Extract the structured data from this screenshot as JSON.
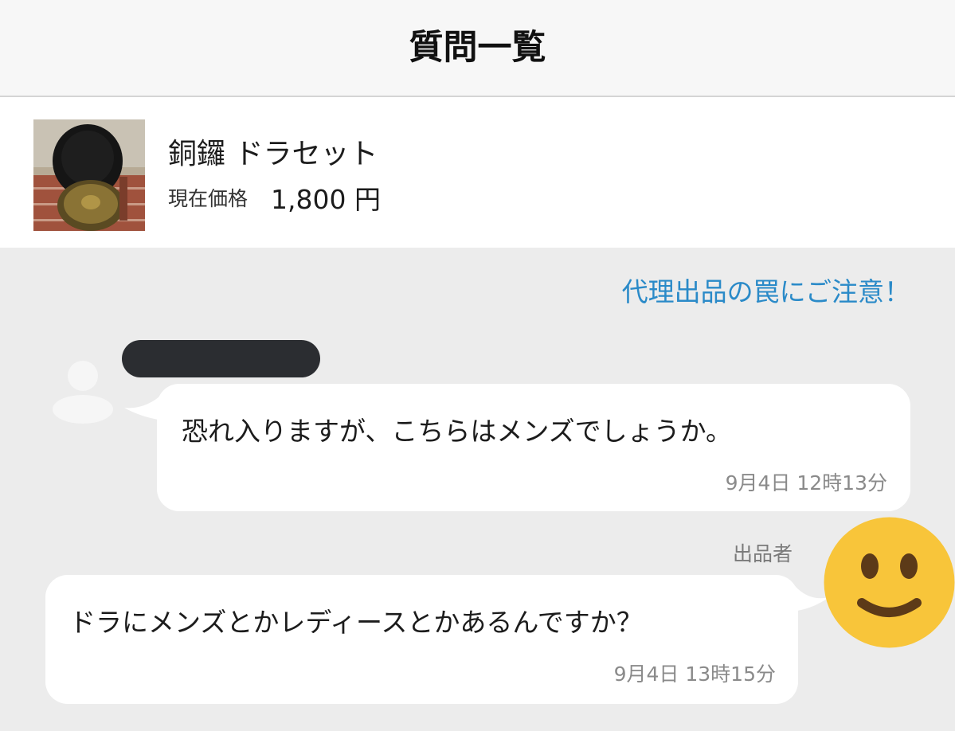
{
  "header": {
    "title": "質問一覧"
  },
  "product": {
    "name": "銅鑼 ドラセット",
    "price_label": "現在価格",
    "price_value": "1,800 円",
    "thumbnail_icon": "gong-set-photo"
  },
  "warning_link": "代理出品の罠にご注意！",
  "messages": [
    {
      "role": "buyer",
      "avatar_icon": "default-user-icon",
      "name_redacted": true,
      "text": "恐れ入りますが、こちらはメンズでしょうか。",
      "time": "9月4日 12時13分"
    },
    {
      "role": "seller",
      "label": "出品者",
      "avatar_icon": "smiley-face-icon",
      "text": "ドラにメンズとかレディースとかあるんですか？",
      "time": "9月4日 13時15分"
    }
  ],
  "colors": {
    "link": "#2a8ac8",
    "background": "#ececec",
    "smiley": "#f8c53a"
  }
}
